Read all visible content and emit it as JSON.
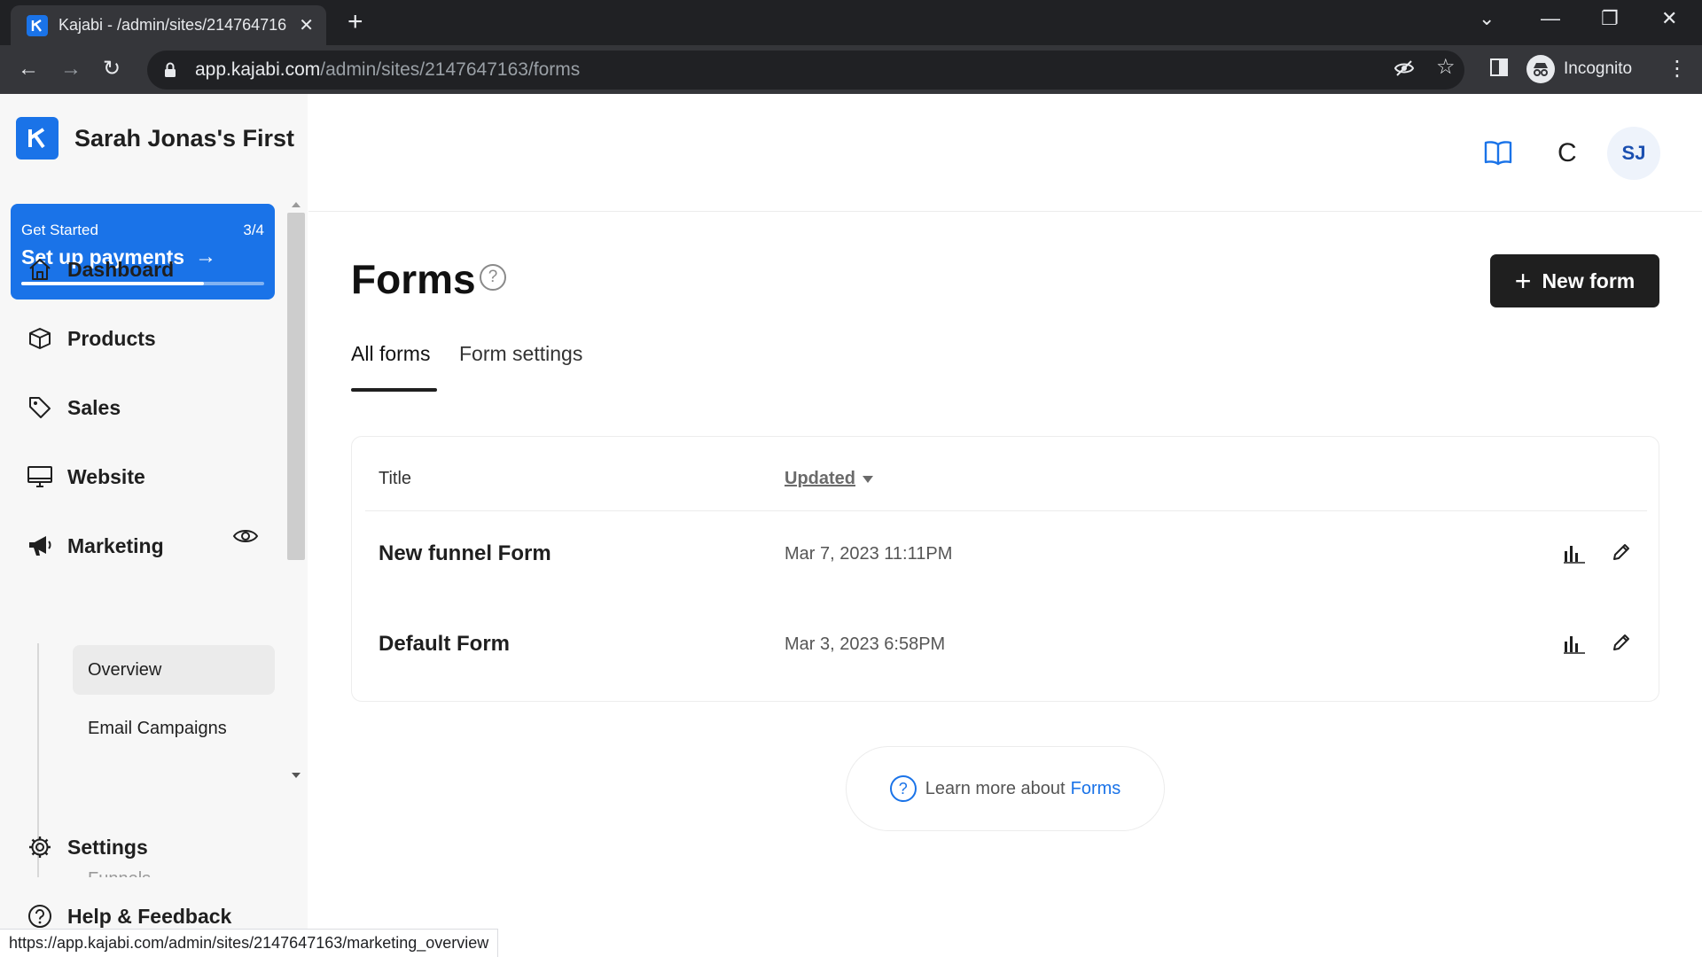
{
  "browser": {
    "tab_title": "Kajabi - /admin/sites/214764716",
    "url_host": "app.kajabi.com",
    "url_path": "/admin/sites/2147647163/forms",
    "incognito_label": "Incognito",
    "status_url": "https://app.kajabi.com/admin/sites/2147647163/marketing_overview"
  },
  "sidebar": {
    "site_name": "Sarah Jonas's First",
    "get_started": {
      "label": "Get Started",
      "count": "3/4",
      "action": "Set up payments",
      "progress": 0.75
    },
    "items": [
      {
        "label": "Dashboard",
        "icon": "home-icon"
      },
      {
        "label": "Products",
        "icon": "box-icon"
      },
      {
        "label": "Sales",
        "icon": "tag-icon"
      },
      {
        "label": "Website",
        "icon": "monitor-icon"
      },
      {
        "label": "Marketing",
        "icon": "megaphone-icon"
      },
      {
        "label": "Settings",
        "icon": "gear-icon"
      },
      {
        "label": "Help & Feedback",
        "icon": "help-icon"
      }
    ],
    "marketing_sub": [
      {
        "label": "Overview"
      },
      {
        "label": "Email Campaigns"
      },
      {
        "label": "Funnels"
      }
    ]
  },
  "header": {
    "avatar_initials": "SJ",
    "truncated_letter": "C"
  },
  "main": {
    "title": "Forms",
    "new_button": "New form",
    "tabs": [
      {
        "label": "All forms"
      },
      {
        "label": "Form settings"
      }
    ],
    "table": {
      "columns": [
        "Title",
        "Updated"
      ],
      "rows": [
        {
          "title": "New funnel Form",
          "updated": "Mar 7, 2023 11:11PM"
        },
        {
          "title": "Default Form",
          "updated": "Mar 3, 2023 6:58PM"
        }
      ]
    },
    "learn_more": {
      "text": "Learn more about",
      "link": "Forms"
    }
  },
  "colors": {
    "accent": "#1a73e8",
    "primary_button": "#1f1f1f"
  }
}
